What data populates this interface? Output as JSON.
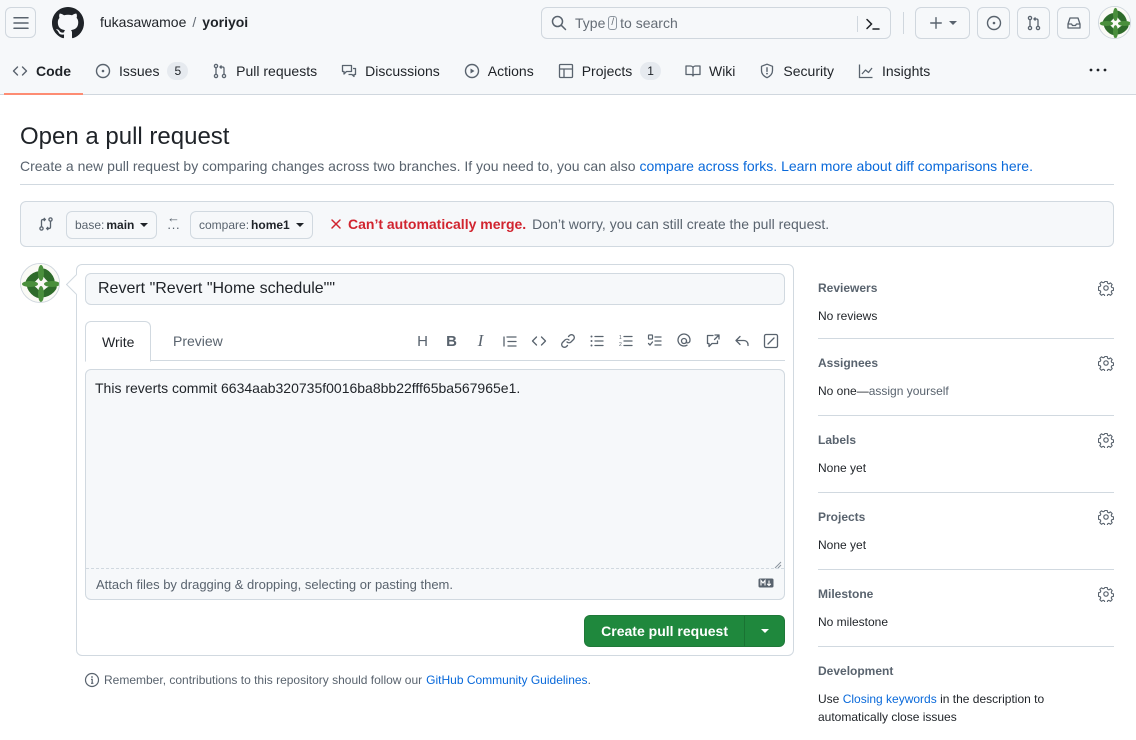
{
  "header": {
    "owner": "fukasawamoe",
    "separator": "/",
    "repo": "yoriyoi",
    "search_prefix": "Type",
    "search_key": "/",
    "search_suffix": "to search"
  },
  "tabs": [
    {
      "label": "Code",
      "icon": "code-icon",
      "active": true
    },
    {
      "label": "Issues",
      "icon": "issue-opened-icon",
      "count": "5"
    },
    {
      "label": "Pull requests",
      "icon": "git-pull-request-icon"
    },
    {
      "label": "Discussions",
      "icon": "comment-discussion-icon"
    },
    {
      "label": "Actions",
      "icon": "play-icon"
    },
    {
      "label": "Projects",
      "icon": "table-icon",
      "count": "1"
    },
    {
      "label": "Wiki",
      "icon": "book-icon"
    },
    {
      "label": "Security",
      "icon": "shield-icon"
    },
    {
      "label": "Insights",
      "icon": "graph-icon"
    }
  ],
  "page": {
    "title": "Open a pull request",
    "subtitle": "Create a new pull request by comparing changes across two branches. If you need to, you can also",
    "link_forks": "compare across forks.",
    "link_learn": "Learn more about diff comparisons here."
  },
  "range": {
    "base_prefix": "base:",
    "base_branch": "main",
    "compare_prefix": "compare:",
    "compare_branch": "home1",
    "merge_error": "Can’t automatically merge.",
    "merge_note": "Don’t worry, you can still create the pull request."
  },
  "composer": {
    "title_value": "Revert \"Revert \"Home schedule\"\"",
    "tab_write": "Write",
    "tab_preview": "Preview",
    "toolbar": [
      "heading",
      "bold",
      "italic",
      "quote",
      "code",
      "link",
      "unordered-list",
      "ordered-list",
      "task-list",
      "mention",
      "reference",
      "reply",
      "fullscreen"
    ],
    "body_value": "This reverts commit 6634aab320735f0016ba8bb22fff65ba567965e1.",
    "attach_text": "Attach files by dragging & dropping, selecting or pasting them.",
    "create_label": "Create pull request"
  },
  "guidelines": {
    "text": "Remember, contributions to this repository should follow our",
    "link": "GitHub Community Guidelines",
    "end": "."
  },
  "sidebar": {
    "reviewers": {
      "title": "Reviewers",
      "value": "No reviews"
    },
    "assignees": {
      "title": "Assignees",
      "value": "No one—",
      "link": "assign yourself"
    },
    "labels": {
      "title": "Labels",
      "value": "None yet"
    },
    "projects": {
      "title": "Projects",
      "value": "None yet"
    },
    "milestone": {
      "title": "Milestone",
      "value": "No milestone"
    },
    "development": {
      "title": "Development",
      "prefix": "Use",
      "link": "Closing keywords",
      "suffix": "in the description to automatically close issues"
    }
  },
  "colors": {
    "accent_link": "#0969da",
    "primary_button": "#1f883d",
    "error": "#d1242f",
    "active_tab_underline": "#fd8c73"
  }
}
